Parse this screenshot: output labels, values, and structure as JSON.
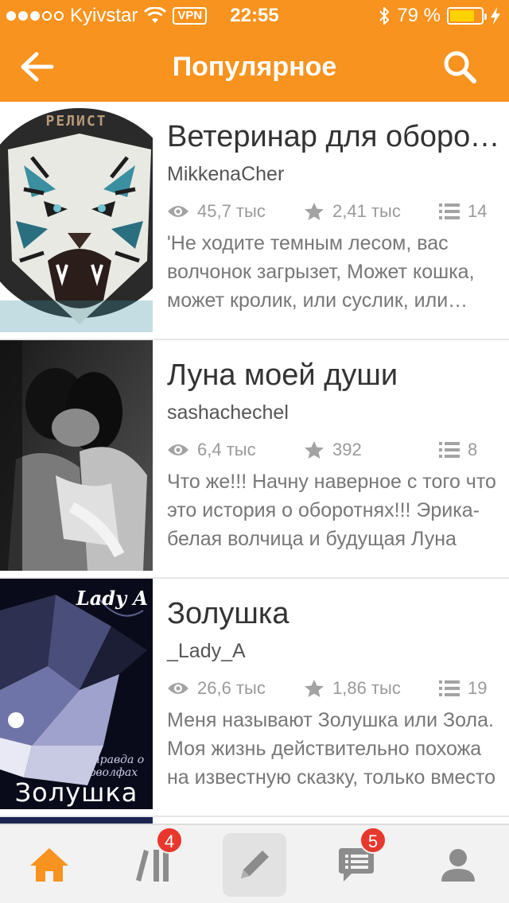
{
  "status_bar": {
    "carrier": "Kyivstar",
    "vpn": "VPN",
    "time": "22:55",
    "battery": "79 %",
    "battery_level": 0.79
  },
  "header": {
    "title": "Популярное",
    "back_icon": "arrow-left-icon",
    "search_icon": "search-icon"
  },
  "stories": [
    {
      "title": "Ветеринар для оборотней",
      "author": "MikkenaCher",
      "views": "45,7 тыс",
      "votes": "2,41 тыс",
      "parts": "14",
      "description": "'Не ходите темным лесом, вас волчонок загрызет,    Может кошка, может кролик, или суслик, или барсук'",
      "cover_text": "РЕЛИСТ"
    },
    {
      "title": "Луна моей души",
      "author": "sashachechel",
      "views": "6,4 тыс",
      "votes": "392",
      "parts": "8",
      "description": "Что же!!! Начну наверное с того что это история о оборотнях!!! Эрика-белая волчица и будущая Луна",
      "cover_text": ""
    },
    {
      "title": "Золушка",
      "author": "_Lady_A",
      "views": "26,6 тыс",
      "votes": "1,86 тыс",
      "parts": "19",
      "description": "Меня называют Золушка или Зола. Моя жизнь действительно похожа на известную сказку, только вместо",
      "cover_text": "Золушка",
      "cover_top_text": "Lady A",
      "cover_sub_text": "Вся правда о Верволфах"
    }
  ],
  "tab_bar": {
    "home_icon": "home-icon",
    "library_icon": "library-icon",
    "library_badge": "4",
    "write_icon": "pencil-icon",
    "messages_icon": "messages-icon",
    "messages_badge": "5",
    "profile_icon": "profile-icon",
    "active_color": "#f7931e",
    "inactive_color": "#8c8c8c"
  },
  "colors": {
    "brand": "#f7931e",
    "badge": "#e8382d"
  }
}
